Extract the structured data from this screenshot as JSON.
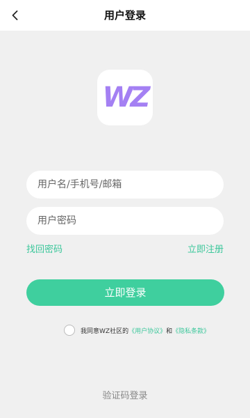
{
  "header": {
    "title": "用户登录",
    "back_icon": "chevron-left-icon"
  },
  "logo": {
    "text": "WZ",
    "color": "#a480f3"
  },
  "form": {
    "username_placeholder": "用户名/手机号/邮箱",
    "password_placeholder": "用户密码",
    "forgot_label": "找回密码",
    "register_label": "立即注册",
    "login_label": "立即登录"
  },
  "agreement": {
    "prefix": "我同意WZ社区的",
    "user_agreement": "《用户协议》",
    "and": "和",
    "privacy_policy": "《隐私条款》",
    "checked": false
  },
  "alt_login": {
    "label": "验证码登录"
  },
  "colors": {
    "accent": "#3fcf9e",
    "background": "#f0f0f0"
  }
}
